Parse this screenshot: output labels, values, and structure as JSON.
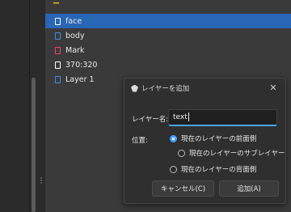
{
  "layers": [
    {
      "name": "face",
      "icon": "layer-icon-blue",
      "selected": true
    },
    {
      "name": "body",
      "icon": "layer-icon-blue",
      "selected": false
    },
    {
      "name": "Mark",
      "icon": "layer-icon-red",
      "selected": false
    },
    {
      "name": "370:320",
      "icon": "layer-icon-white",
      "selected": false
    },
    {
      "name": "Layer 1",
      "icon": "layer-icon-blue",
      "selected": false
    }
  ],
  "dialog": {
    "title": "レイヤーを追加",
    "close_glyph": "✕",
    "name_label": "レイヤー名:",
    "name_value": "text",
    "position_label": "位置:",
    "options": [
      {
        "label": "現在のレイヤーの前面側",
        "checked": true
      },
      {
        "label": "現在のレイヤーのサブレイヤー",
        "checked": false
      },
      {
        "label": "現在のレイヤーの背面側",
        "checked": false
      }
    ],
    "cancel_label": "キャンセル(C)",
    "add_label": "追加(A)"
  },
  "colors": {
    "selection": "#2866b6",
    "accent": "#4aa3ff",
    "panel_bg": "#3a3a3a",
    "dialog_bg": "#2f2f2f"
  }
}
